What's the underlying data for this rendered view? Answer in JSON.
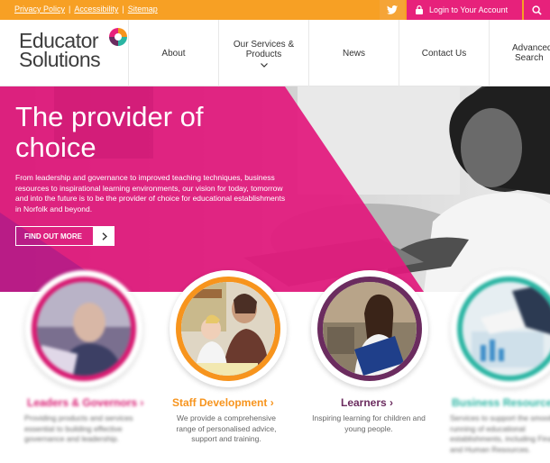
{
  "topbar": {
    "links": [
      "Privacy Policy",
      "Accessibility",
      "Sitemap"
    ],
    "separator": "|",
    "twitter_icon": "twitter-icon",
    "login_label": "Login to Your Account",
    "search_icon": "search-icon",
    "colors": {
      "bar": "#f7a024",
      "accent": "#e7217b"
    }
  },
  "header": {
    "logo_line1": "Educator",
    "logo_line2": "Solutions",
    "nav": [
      {
        "label": "About"
      },
      {
        "label": "Our Services &",
        "label2": "Products"
      },
      {
        "label": "News"
      },
      {
        "label": "Contact Us"
      },
      {
        "label": "Advanced",
        "label2": "Search"
      }
    ]
  },
  "hero": {
    "title_line1": "The provider of",
    "title_line2": "choice",
    "text": "From leadership and governance to improved teaching techniques, business resources to inspirational learning environments, our vision for today, tomorrow and into the future is to be the provider of choice for educational establishments in Norfolk and beyond.",
    "button_label": "FIND OUT MORE",
    "colors": {
      "overlay": "#e2197d"
    }
  },
  "cards": [
    {
      "title": "Leaders & Governors",
      "desc": "Providing products and services essential to building effective governance and leadership.",
      "color": "#d81b72"
    },
    {
      "title": "Staff Development",
      "desc": "We provide a comprehensive range of personalised advice, support and training.",
      "color": "#f7941d"
    },
    {
      "title": "Learners",
      "desc": "Inspiring learning for children and young people.",
      "color": "#6b2c5f"
    },
    {
      "title": "Business Resources",
      "desc": "Services to support the smooth running of educational establishments, including Finance and Human Resources.",
      "color": "#2bb5a3"
    }
  ]
}
